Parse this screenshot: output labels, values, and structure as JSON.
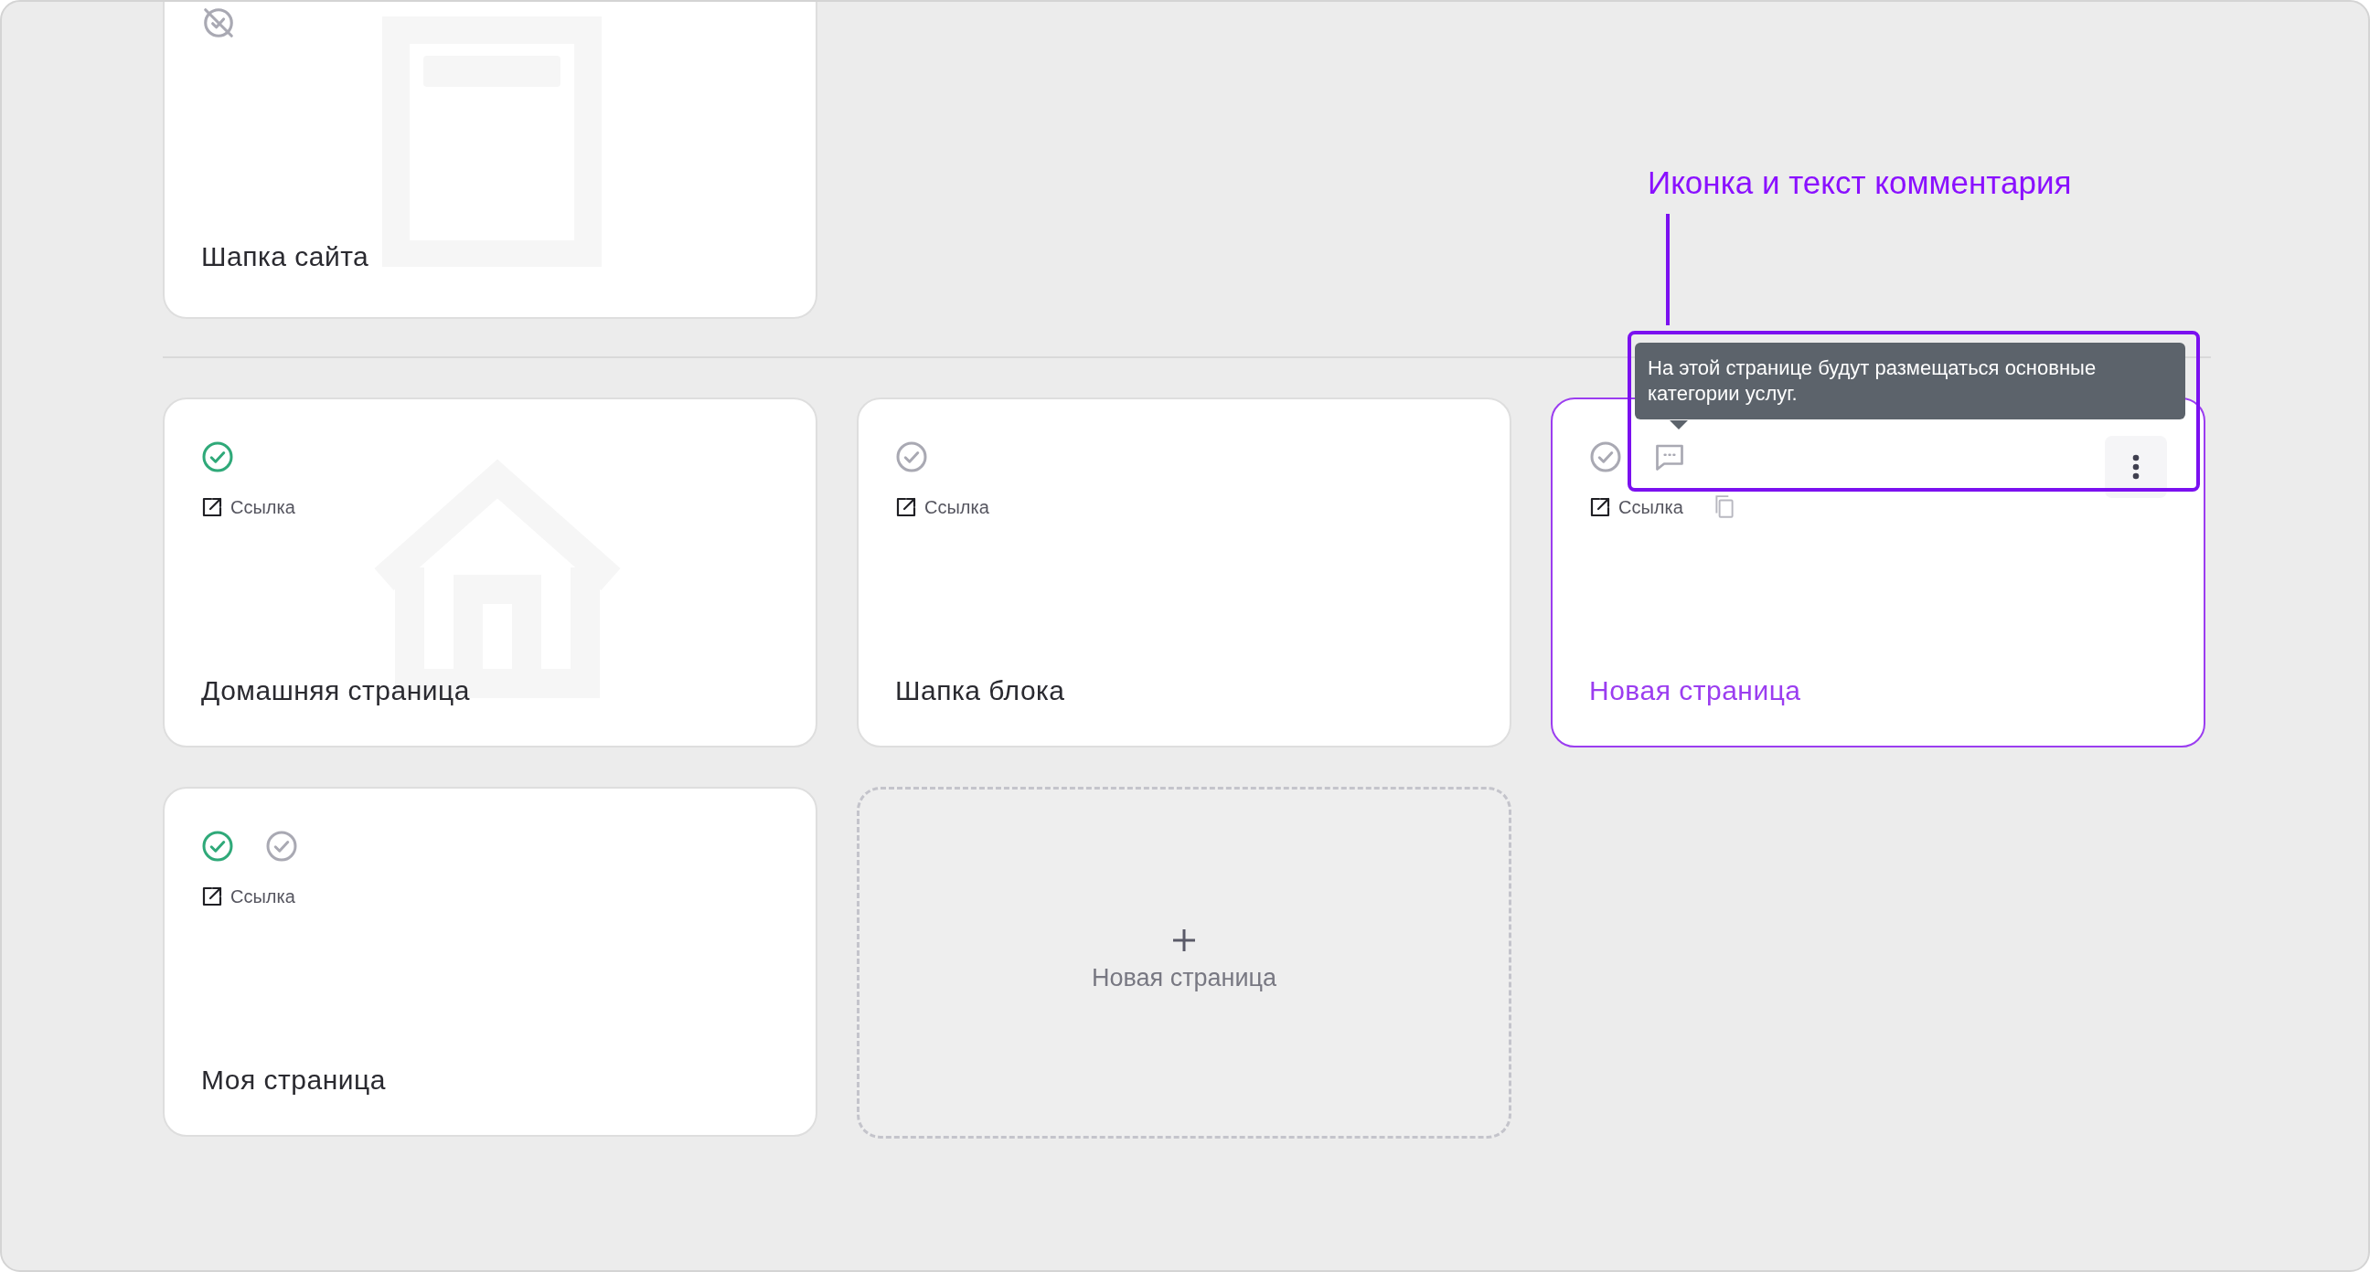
{
  "annotation": {
    "text": "Иконка и текст комментария"
  },
  "top_card": {
    "title": "Шапка сайта",
    "illustration": {
      "kind": "header"
    },
    "statuses": [
      {
        "kind": "hidden"
      }
    ]
  },
  "cards": [
    {
      "title": "Домашняя страница",
      "illustration": {
        "kind": "house"
      },
      "selected": false,
      "statuses": [
        {
          "kind": "published"
        }
      ],
      "link": "Ссылка",
      "copy_button": false
    },
    {
      "title": "Шапка блока",
      "selected": false,
      "statuses": [
        {
          "kind": "checked"
        }
      ],
      "link": "Ссылка",
      "copy_button": false
    },
    {
      "title": "Новая страница",
      "selected": true,
      "statuses": [
        {
          "kind": "checked"
        }
      ],
      "link": "Ссылка",
      "copy_button": true,
      "comment": "На этой странице будут размещаться основные категории услуг.",
      "menu_button": true
    },
    {
      "title": "Моя страница",
      "selected": false,
      "statuses": [
        {
          "kind": "published"
        },
        {
          "kind": "checked"
        }
      ],
      "link": "Ссылка",
      "copy_button": false
    }
  ],
  "new_page": {
    "label": "Новая страница"
  }
}
